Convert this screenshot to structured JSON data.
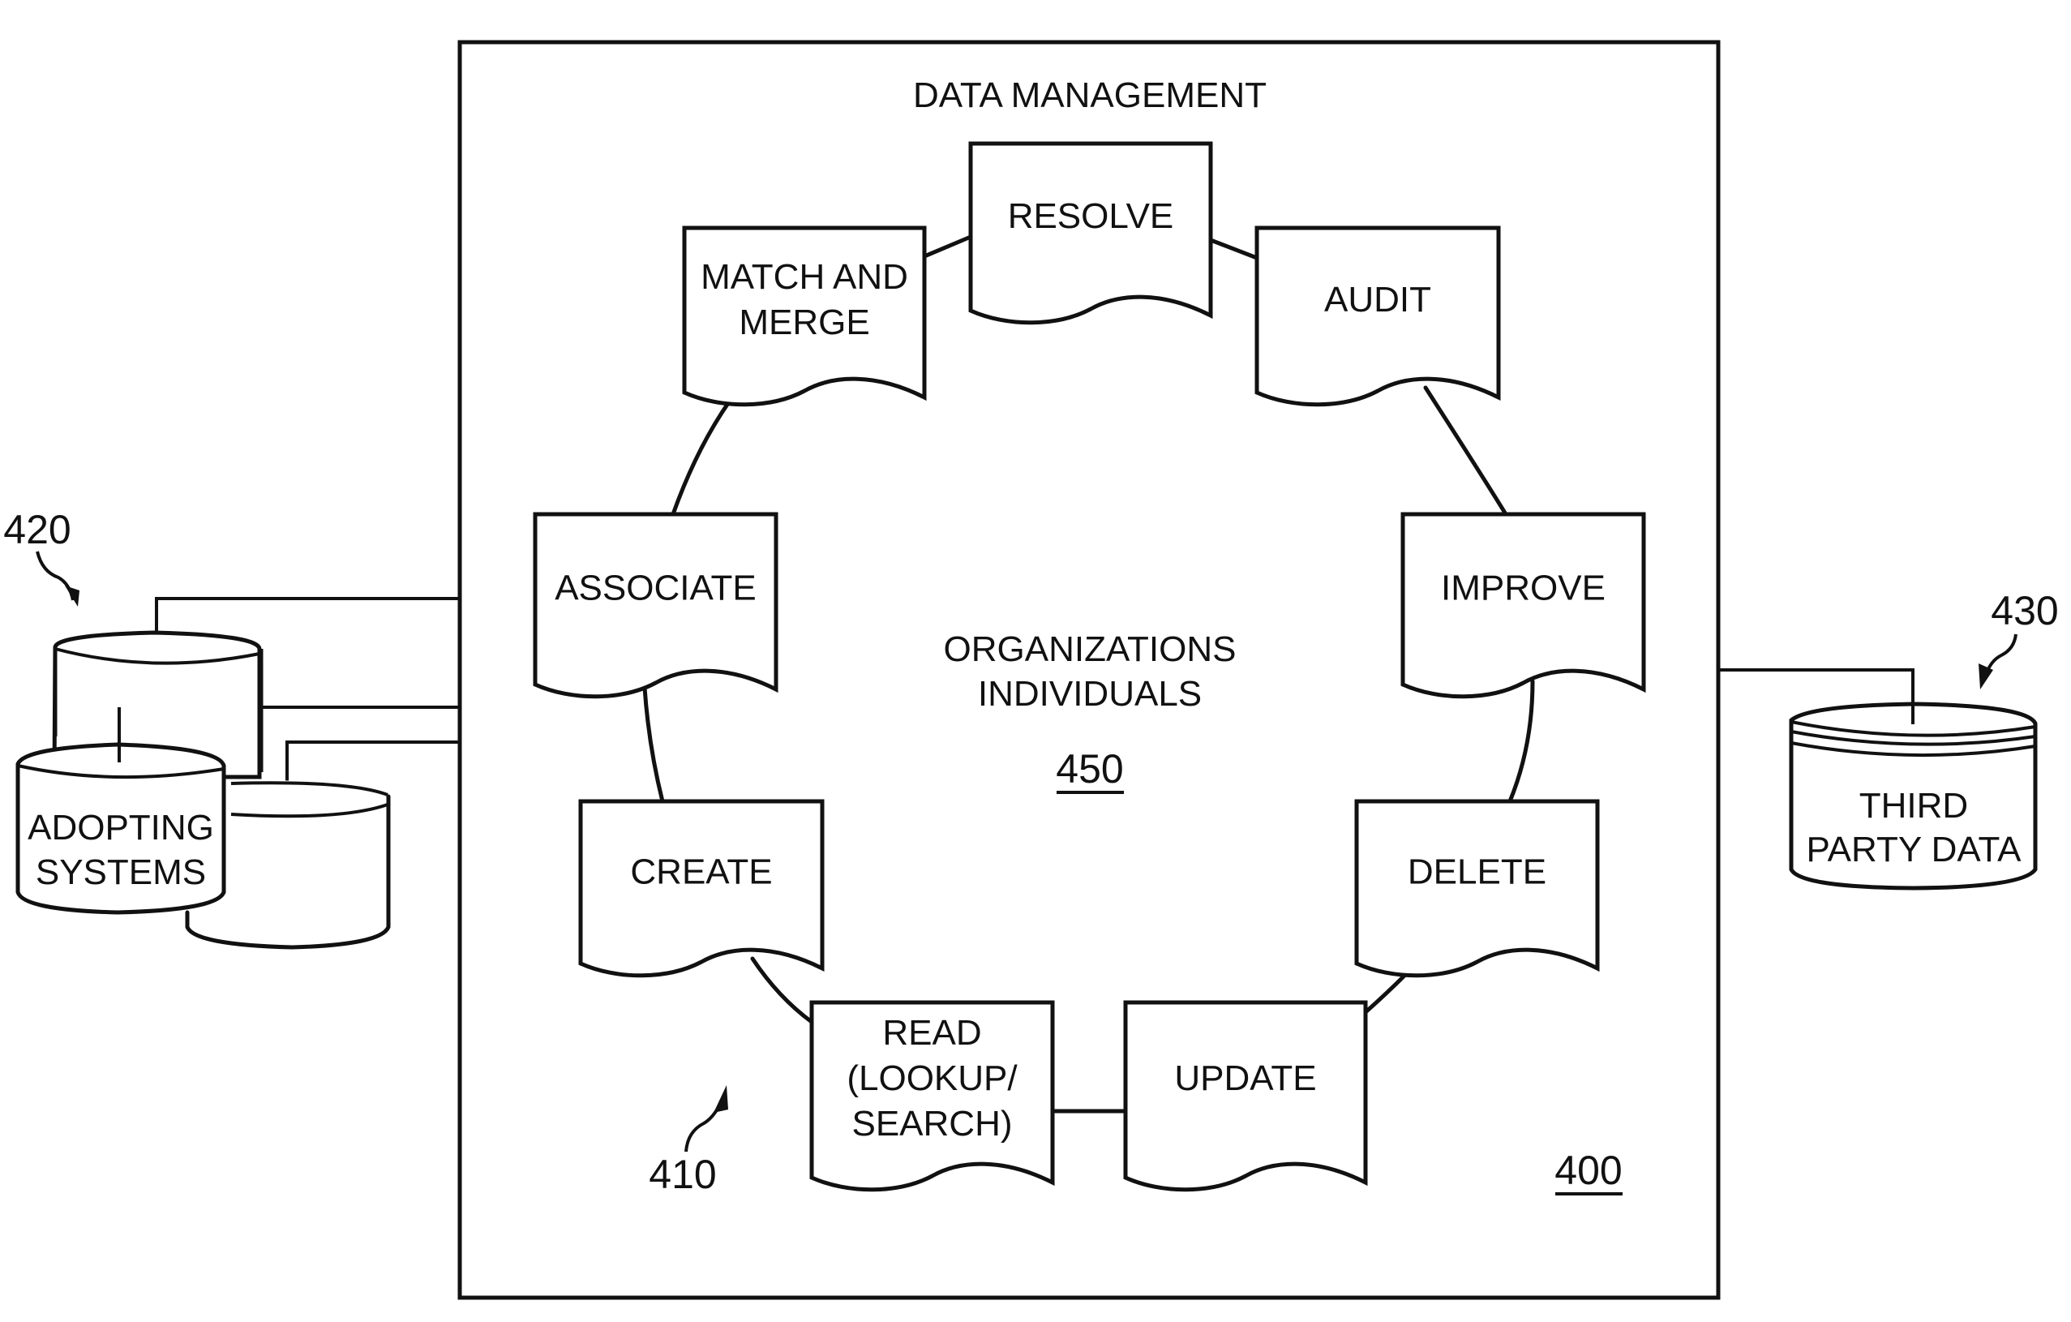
{
  "diagram": {
    "container": {
      "title": "DATA MANAGEMENT",
      "ref": "400"
    },
    "center": {
      "line1": "ORGANIZATIONS",
      "line2": "INDIVIDUALS",
      "ref": "450"
    },
    "cycle_ref": "410",
    "operations": [
      {
        "id": "resolve",
        "lines": [
          "RESOLVE"
        ]
      },
      {
        "id": "audit",
        "lines": [
          "AUDIT"
        ]
      },
      {
        "id": "improve",
        "lines": [
          "IMPROVE"
        ]
      },
      {
        "id": "delete",
        "lines": [
          "DELETE"
        ]
      },
      {
        "id": "update",
        "lines": [
          "UPDATE"
        ]
      },
      {
        "id": "read",
        "lines": [
          "READ",
          "(LOOKUP/",
          "SEARCH)"
        ]
      },
      {
        "id": "create",
        "lines": [
          "CREATE"
        ]
      },
      {
        "id": "associate",
        "lines": [
          "ASSOCIATE"
        ]
      },
      {
        "id": "match-and-merge",
        "lines": [
          "MATCH AND",
          "MERGE"
        ]
      }
    ],
    "adopting_systems": {
      "lines": [
        "ADOPTING",
        "SYSTEMS"
      ],
      "ref": "420"
    },
    "third_party": {
      "lines": [
        "THIRD",
        "PARTY DATA"
      ],
      "ref": "430"
    }
  }
}
